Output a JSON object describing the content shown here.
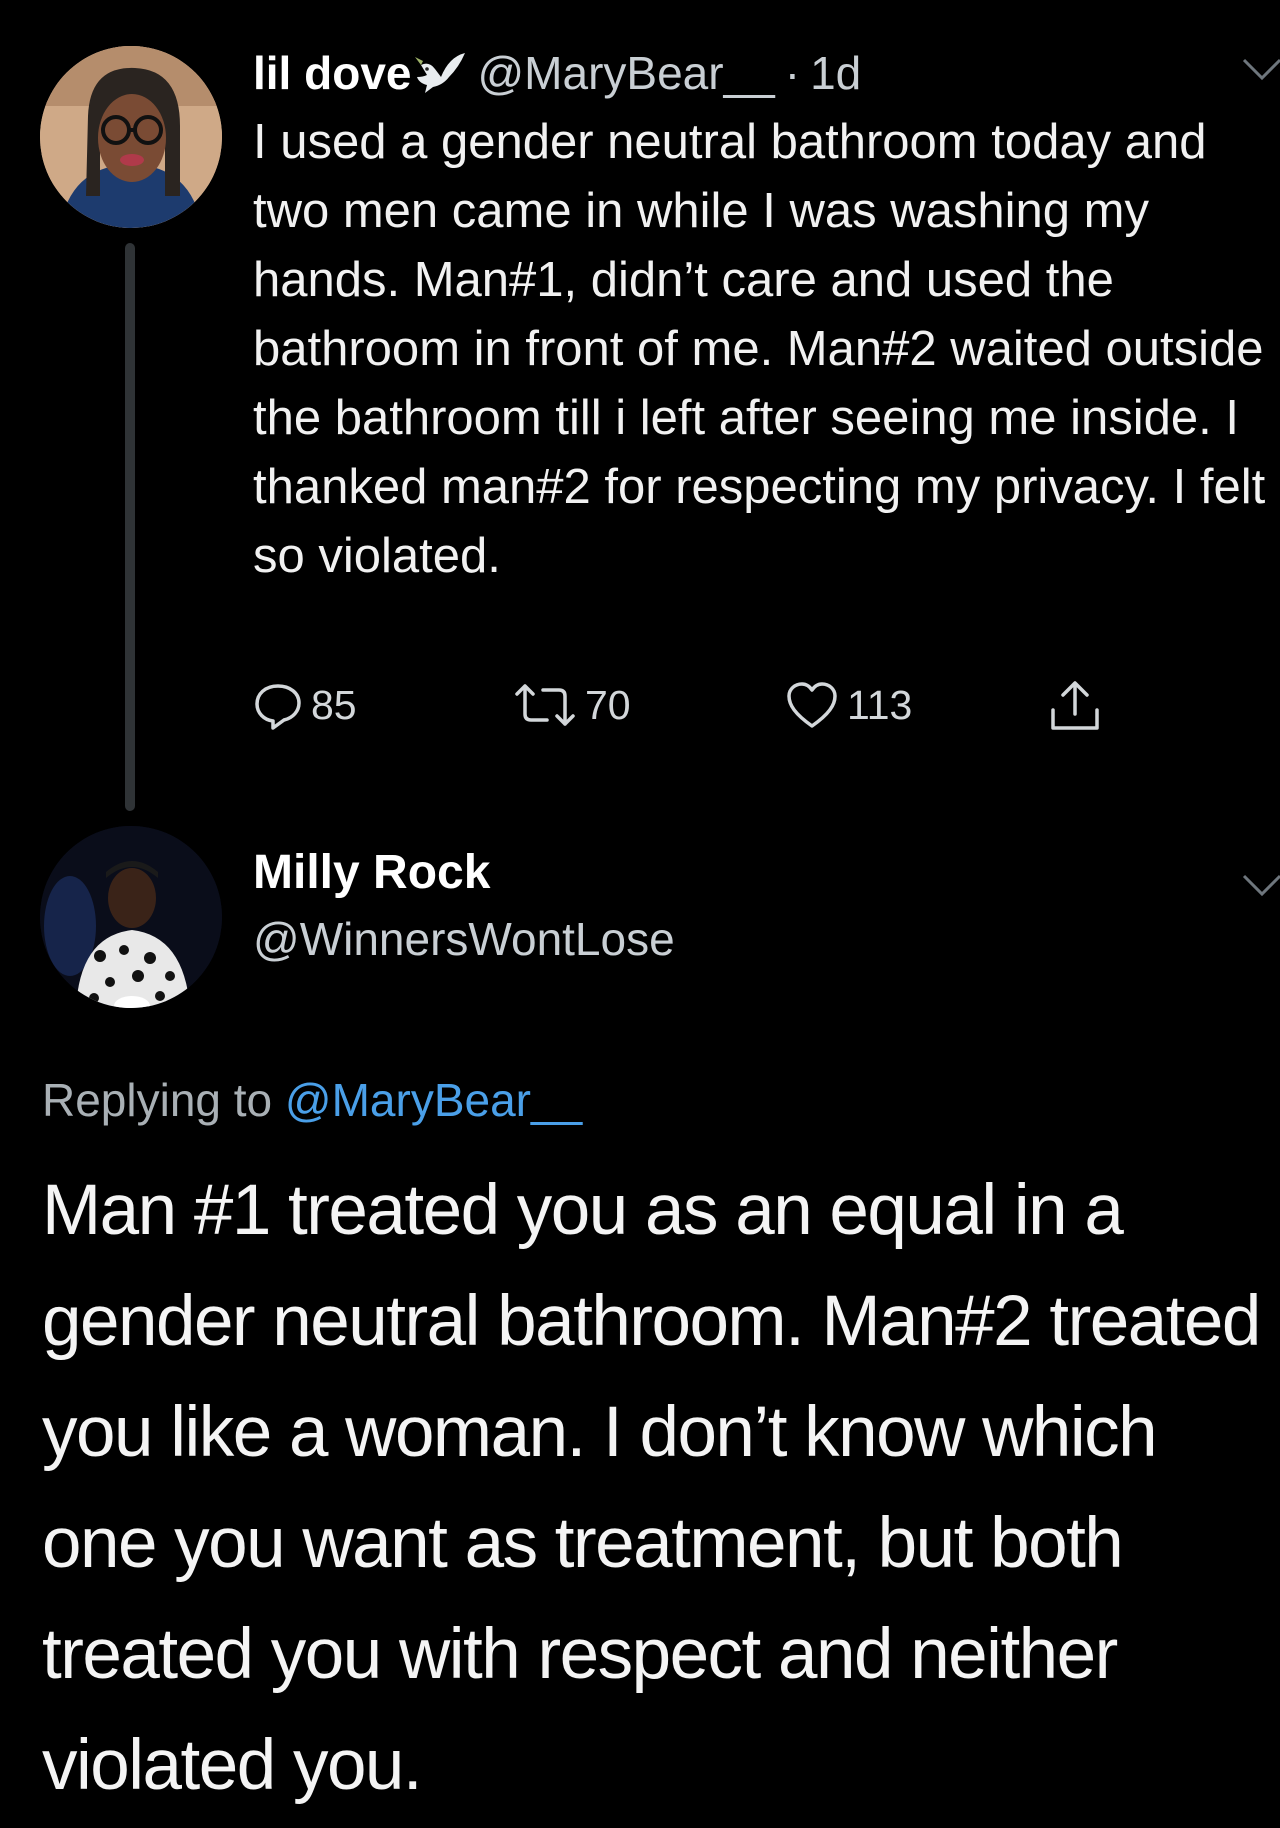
{
  "original_tweet": {
    "display_name": "lil dove",
    "handle": "@MaryBear__",
    "separator": "·",
    "timestamp": "1d",
    "text": "I used a gender neutral bathroom today and two men came in while I was washing my hands. Man#1, didn’t care and used the bathroom in front of me. Man#2 waited outside the bathroom till i left after seeing me inside. I thanked man#2 for respecting my privacy. I felt so violated.",
    "replies": "85",
    "retweets": "70",
    "likes": "113",
    "icons": {
      "name_emoji": "dove-icon",
      "more": "chevron-down-icon",
      "reply": "reply-icon",
      "retweet": "retweet-icon",
      "like": "heart-icon",
      "share": "share-icon"
    }
  },
  "reply_tweet": {
    "display_name": "Milly Rock",
    "handle": "@WinnersWontLose",
    "replying_prefix": "Replying to",
    "replying_mention": "@MaryBear__",
    "text": "Man #1 treated you as an equal in a gender neutral bathroom. Man#2 treated you like a woman. I don’t know which one you want as treatment, but both treated you with respect and neither violated you.",
    "icons": {
      "more": "chevron-down-icon"
    }
  },
  "colors": {
    "background": "#000000",
    "text": "#ffffff",
    "muted_text": "#c9cfd4",
    "link": "#4a9fe8",
    "thread_line": "#2f3336"
  }
}
